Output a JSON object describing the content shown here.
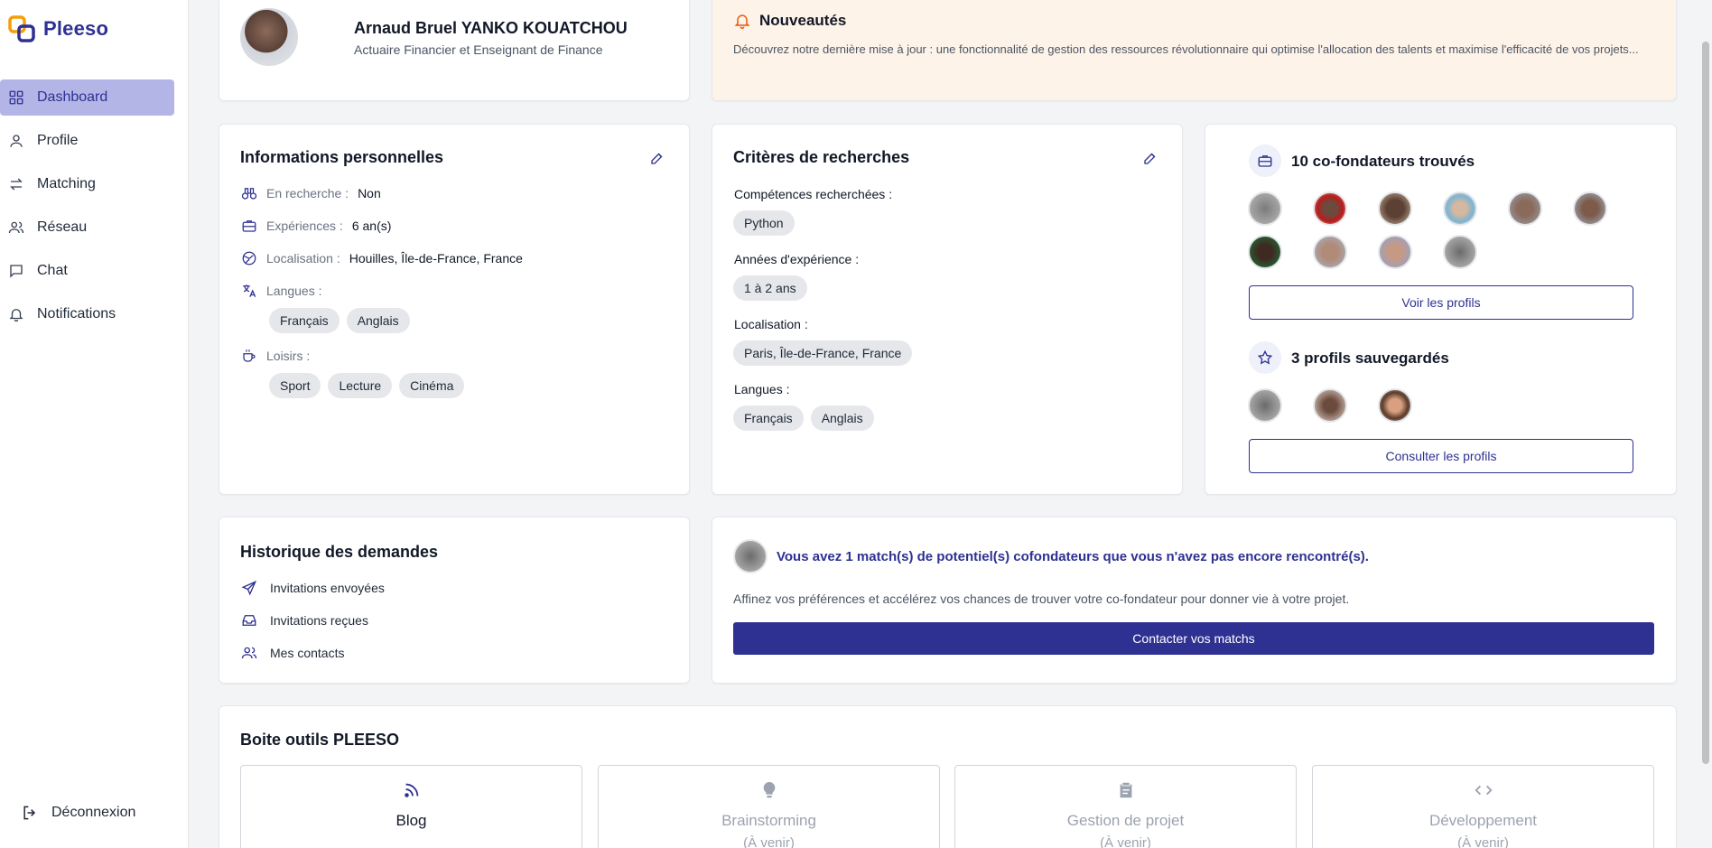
{
  "brand": {
    "name": "Pleeso",
    "accent": "#2e3192",
    "logo_orange": "#f59e0b"
  },
  "sidebar": {
    "items": [
      {
        "label": "Dashboard",
        "icon": "grid-icon",
        "active": true
      },
      {
        "label": "Profile",
        "icon": "user-icon"
      },
      {
        "label": "Matching",
        "icon": "arrows-exchange-icon"
      },
      {
        "label": "Réseau",
        "icon": "users-icon"
      },
      {
        "label": "Chat",
        "icon": "message-icon"
      },
      {
        "label": "Notifications",
        "icon": "bell-icon"
      }
    ],
    "logout": "Déconnexion"
  },
  "profile": {
    "name": "Arnaud Bruel YANKO KOUATCHOU",
    "title": "Actuaire Financier et Enseignant de Finance"
  },
  "news": {
    "title": "Nouveautés",
    "text": "Découvrez notre dernière mise à jour : une fonctionnalité de gestion des ressources révolutionnaire qui optimise l'allocation des talents et maximise l'efficacité de vos projets...",
    "bg": "#fef3e9"
  },
  "personal": {
    "title": "Informations personnelles",
    "searching_label": "En recherche :",
    "searching_value": "Non",
    "experience_label": "Expériences :",
    "experience_value": "6 an(s)",
    "location_label": "Localisation :",
    "location_value": "Houilles, Île-de-France, France",
    "languages_label": "Langues :",
    "languages": [
      "Français",
      "Anglais"
    ],
    "hobbies_label": "Loisirs :",
    "hobbies": [
      "Sport",
      "Lecture",
      "Cinéma"
    ]
  },
  "criteria": {
    "title": "Critères de recherches",
    "skills_label": "Compétences recherchées :",
    "skills": [
      "Python"
    ],
    "years_label": "Années d'expérience :",
    "years": [
      "1 à 2 ans"
    ],
    "location_label": "Localisation :",
    "locations": [
      "Paris, Île-de-France, France"
    ],
    "languages_label": "Langues :",
    "languages": [
      "Français",
      "Anglais"
    ]
  },
  "cofounders": {
    "title": "10 co-fondateurs trouvés",
    "button": "Voir les profils",
    "saved_title": "3 profils sauvegardés",
    "saved_button": "Consulter les profils"
  },
  "history": {
    "title": "Historique des demandes",
    "items": [
      "Invitations envoyées",
      "Invitations reçues",
      "Mes contacts"
    ]
  },
  "match": {
    "headline": "Vous avez 1 match(s) de potentiel(s) cofondateurs que vous n'avez pas encore rencontré(s).",
    "text": "Affinez vos préférences et accélérez vos chances de trouver votre co-fondateur pour donner vie à votre projet.",
    "button": "Contacter vos matchs"
  },
  "toolbox": {
    "title": "Boite outils PLEESO",
    "tools": [
      {
        "title": "Blog",
        "subtitle": "",
        "icon": "rss-icon"
      },
      {
        "title": "Brainstorming",
        "subtitle": "(À venir)",
        "icon": "lightbulb-icon"
      },
      {
        "title": "Gestion de projet",
        "subtitle": "(À venir)",
        "icon": "clipboard-icon"
      },
      {
        "title": "Développement",
        "subtitle": "(À venir)",
        "icon": "code-icon"
      }
    ]
  }
}
